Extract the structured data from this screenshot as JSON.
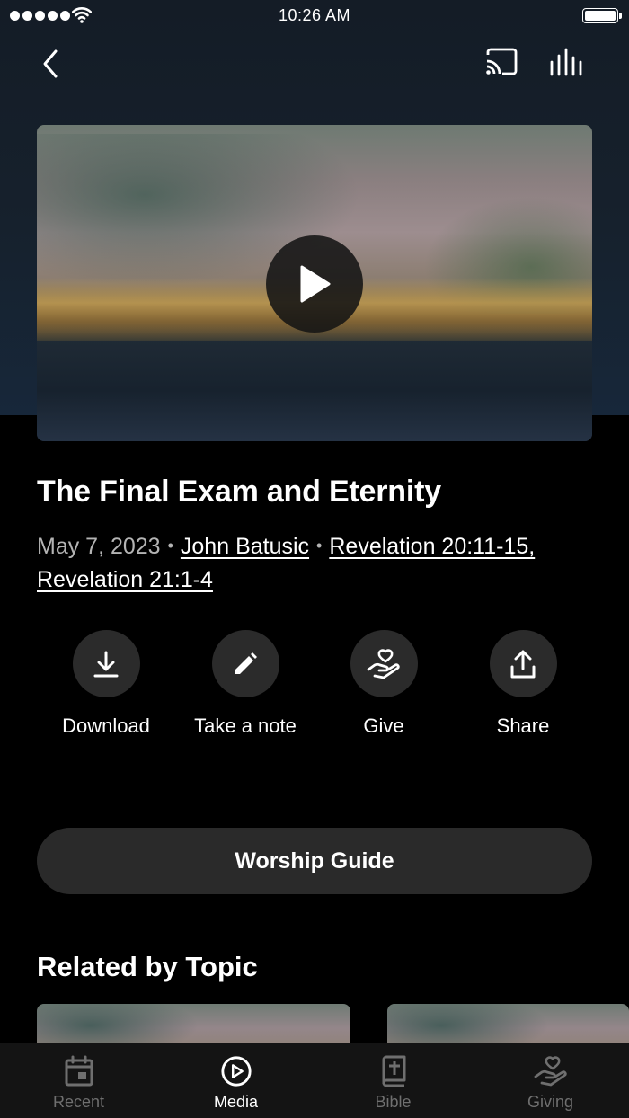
{
  "status_bar": {
    "time": "10:26 AM"
  },
  "video": {
    "title": "The Final Exam and Eternity",
    "date": "May 7, 2023",
    "speaker": "John Batusic",
    "scripture_1": "Revelation 20:11-15,",
    "scripture_2": "Revelation 21:1-4"
  },
  "actions": [
    {
      "label": "Download",
      "icon": "download-icon"
    },
    {
      "label": "Take a note",
      "icon": "pencil-icon"
    },
    {
      "label": "Give",
      "icon": "hand-heart-icon"
    },
    {
      "label": "Share",
      "icon": "share-icon"
    }
  ],
  "worship_guide": {
    "label": "Worship Guide"
  },
  "related": {
    "title": "Related by Topic"
  },
  "tabs": [
    {
      "label": "Recent",
      "icon": "calendar-icon",
      "active": false
    },
    {
      "label": "Media",
      "icon": "play-circle-icon",
      "active": true
    },
    {
      "label": "Bible",
      "icon": "bible-icon",
      "active": false
    },
    {
      "label": "Giving",
      "icon": "hand-heart-icon",
      "active": false
    }
  ],
  "colors": {
    "background": "#000000",
    "header": "#16212d",
    "button": "#2b2b2b",
    "inactive_tab": "#6f6f6f"
  }
}
